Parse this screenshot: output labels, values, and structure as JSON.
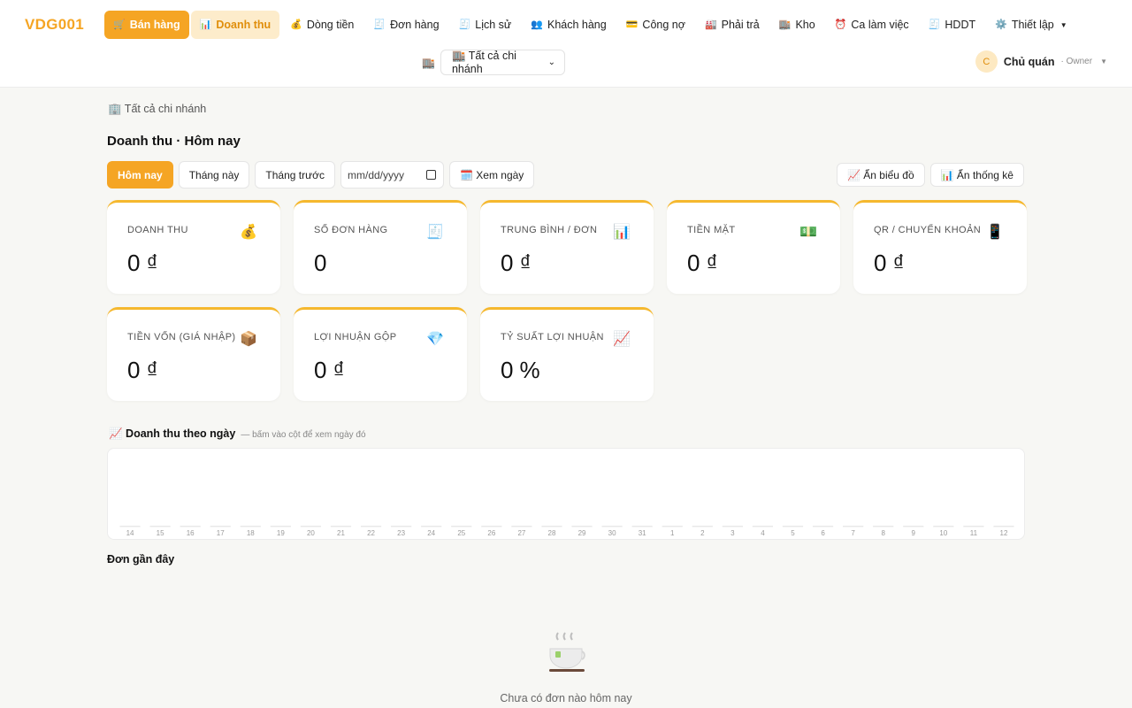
{
  "app": {
    "logo": "VDG001"
  },
  "nav": [
    {
      "label": "Bán hàng",
      "icon": "🛒"
    },
    {
      "label": "Doanh thu",
      "icon": "📊"
    },
    {
      "label": "Dòng tiền",
      "icon": "💰"
    },
    {
      "label": "Đơn hàng",
      "icon": "🧾"
    },
    {
      "label": "Lịch sử",
      "icon": "🧾"
    },
    {
      "label": "Khách hàng",
      "icon": "👥"
    },
    {
      "label": "Công nợ",
      "icon": "💳"
    },
    {
      "label": "Phải trả",
      "icon": "🏭"
    },
    {
      "label": "Kho",
      "icon": "🏬"
    },
    {
      "label": "Ca làm việc",
      "icon": "⏰"
    },
    {
      "label": "HDDT",
      "icon": "🧾"
    },
    {
      "label": "Thiết lập",
      "icon": "⚙️"
    }
  ],
  "branch": {
    "icon": "🏬",
    "selected": "🏬 Tất cả chi nhánh"
  },
  "user": {
    "initial": "C",
    "name": "Chủ quán",
    "role": "· Owner"
  },
  "breadcrumb": "🏢 Tất cả chi nhánh",
  "page_title": "Doanh thu · Hôm nay",
  "filters": {
    "today": "Hôm nay",
    "this_month": "Tháng này",
    "last_month": "Tháng trước",
    "date_placeholder": "mm/dd/yyyy",
    "view_day": "🗓️ Xem ngày",
    "hide_chart": "📈 Ẩn biểu đồ",
    "hide_stats": "📊 Ẩn thống kê"
  },
  "stats": [
    {
      "label": "Doanh thu",
      "icon": "💰",
      "value": "0",
      "unit": "₫"
    },
    {
      "label": "Số đơn hàng",
      "icon": "🧾",
      "value": "0",
      "unit": ""
    },
    {
      "label": "Trung bình / đơn",
      "icon": "📊",
      "value": "0",
      "unit": "₫"
    },
    {
      "label": "Tiền mặt",
      "icon": "💵",
      "value": "0",
      "unit": "₫"
    },
    {
      "label": "QR / Chuyển khoản",
      "icon": "📱",
      "value": "0",
      "unit": "₫"
    },
    {
      "label": "Tiền vốn (giá nhập)",
      "icon": "📦",
      "value": "0",
      "unit": "₫"
    },
    {
      "label": "Lợi nhuận gộp",
      "icon": "💎",
      "value": "0",
      "unit": "₫"
    },
    {
      "label": "Tỷ suất lợi nhuận",
      "icon": "📈",
      "value": "0",
      "unit": "%"
    }
  ],
  "chart_section": {
    "title": "📈 Doanh thu theo ngày",
    "hint": "— bấm vào cột để xem ngày đó"
  },
  "chart_data": {
    "type": "bar",
    "categories": [
      "14",
      "15",
      "16",
      "17",
      "18",
      "19",
      "20",
      "21",
      "22",
      "23",
      "24",
      "25",
      "26",
      "27",
      "28",
      "29",
      "30",
      "31",
      "1",
      "2",
      "3",
      "4",
      "5",
      "6",
      "7",
      "8",
      "9",
      "10",
      "11",
      "12"
    ],
    "values": [
      0,
      0,
      0,
      0,
      0,
      0,
      0,
      0,
      0,
      0,
      0,
      0,
      0,
      0,
      0,
      0,
      0,
      0,
      0,
      0,
      0,
      0,
      0,
      0,
      0,
      0,
      0,
      0,
      0,
      0
    ],
    "title": "",
    "xlabel": "",
    "ylabel": "",
    "grid": false,
    "colors": {
      "bar": "#f5a524",
      "baseline": "#e8e8e8",
      "tick": "#9a9a9a"
    }
  },
  "recent": {
    "title": "Đơn gần đây",
    "empty_text": "Chưa có đơn nào hôm nay",
    "empty_icon": "teacup-icon"
  }
}
